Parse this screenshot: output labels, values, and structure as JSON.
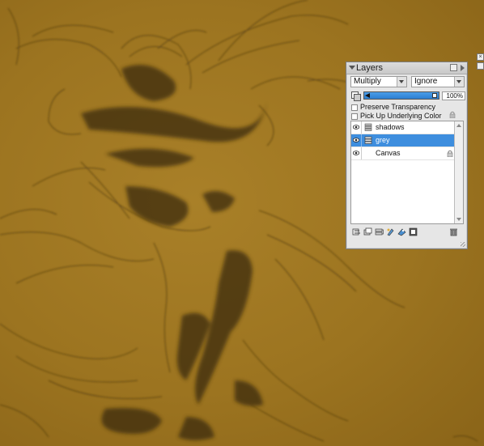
{
  "panel": {
    "title": "Layers",
    "blend_mode": "Multiply",
    "composite_method": "Ignore",
    "opacity": "100%",
    "opacity_fraction": 1.0,
    "preserve_transparency": {
      "label": "Preserve Transparency",
      "checked": false
    },
    "pick_up_underlying_color": {
      "label": "Pick Up Underlying Color",
      "checked": false
    },
    "layers": [
      {
        "name": "shadows",
        "visible": true,
        "selected": false,
        "icon": "layer-stack-icon"
      },
      {
        "name": "grey",
        "visible": true,
        "selected": true,
        "icon": "layer-stack-icon"
      },
      {
        "name": "Canvas",
        "visible": true,
        "selected": false,
        "locked": true,
        "icon": "lock-icon"
      }
    ],
    "footer_icons": [
      "layer-adjust-icon",
      "new-layer-icon",
      "group-layers-icon",
      "dynamic-plugin-icon",
      "mask-icon",
      "create-mask-icon",
      "trash-icon"
    ]
  },
  "colors": {
    "canvas_bg": "#a27a22",
    "selection": "#3e8ede",
    "panel_bg": "#e6e6e6"
  }
}
